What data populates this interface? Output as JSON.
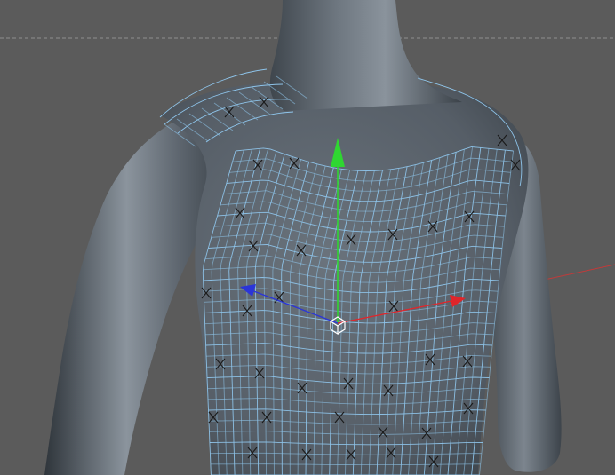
{
  "viewport": {
    "background": "#5b5b5b",
    "horizon_color": "#8f8f8f"
  },
  "model": {
    "body_color": "#5d6670",
    "wire_color": "#8ec4ea",
    "marker_icon": "x-mark-icon"
  },
  "gizmo": {
    "type": "move-tool",
    "y_axis_color": "#2fd631",
    "x_axis_color": "#e0262b",
    "z_axis_color": "#2b35d8",
    "center_color": "#ffffff"
  }
}
